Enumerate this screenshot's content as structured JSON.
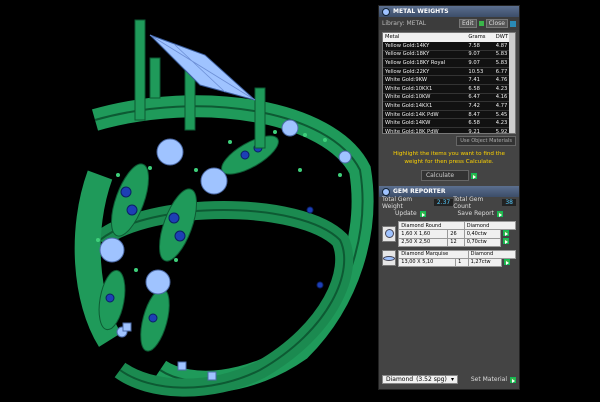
{
  "metal_weights": {
    "title": "METAL WEIGHTS",
    "library_label": "Library: METAL",
    "edit_label": "Edit",
    "close_label": "Close",
    "columns": [
      "Metal",
      "Grams",
      "DWT"
    ],
    "rows": [
      [
        "Yellow Gold:14KY",
        "7.58",
        "4.87"
      ],
      [
        "Yellow Gold:18KY",
        "9.07",
        "5.83"
      ],
      [
        "Yellow Gold:18KY Royal",
        "9.07",
        "5.83"
      ],
      [
        "Yellow Gold:22KY",
        "10.53",
        "6.77"
      ],
      [
        "White Gold:9KW",
        "7.41",
        "4.76"
      ],
      [
        "White Gold:10KX1",
        "6.58",
        "4.23"
      ],
      [
        "White Gold:10KW",
        "6.47",
        "4.16"
      ],
      [
        "White Gold:14KX1",
        "7.42",
        "4.77"
      ],
      [
        "White Gold:14K PdW",
        "8.47",
        "5.45"
      ],
      [
        "White Gold:14KW",
        "6.58",
        "4.23"
      ],
      [
        "White Gold:18K PdW",
        "9.21",
        "5.92"
      ]
    ],
    "use_object_materials": "Use Object Materials",
    "hint": "Highlight the items you want to find the weight for then press Calculate.",
    "calculate_label": "Calculate"
  },
  "gem_reporter": {
    "title": "GEM REPORTER",
    "total_weight_label": "Total Gem Weight",
    "total_weight_value": "2.37",
    "total_count_label": "Total Gem Count",
    "total_count_value": "38",
    "update_label": "Update",
    "save_report_label": "Save Report",
    "groups": [
      {
        "shape": "Diamond Round",
        "material": "Diamond",
        "items": [
          [
            "1,60 X 1,60",
            "26",
            "0,40ctw"
          ],
          [
            "2,50 X 2,50",
            "12",
            "0,70ctw"
          ]
        ]
      },
      {
        "shape": "Diamond Marquise",
        "material": "Diamond",
        "items": [
          [
            "13,00 X 5,10",
            "1",
            "1,27ctw"
          ]
        ]
      }
    ],
    "material_select": "Diamond",
    "material_sg": "(3.52 spg)",
    "set_material_label": "Set Material"
  },
  "colors": {
    "panel_bg": "#444444",
    "header": "#4a5c7c",
    "hint_text": "#ffd400",
    "ring_metal": "#1f9a5a",
    "gem": "#9fc3ff"
  }
}
